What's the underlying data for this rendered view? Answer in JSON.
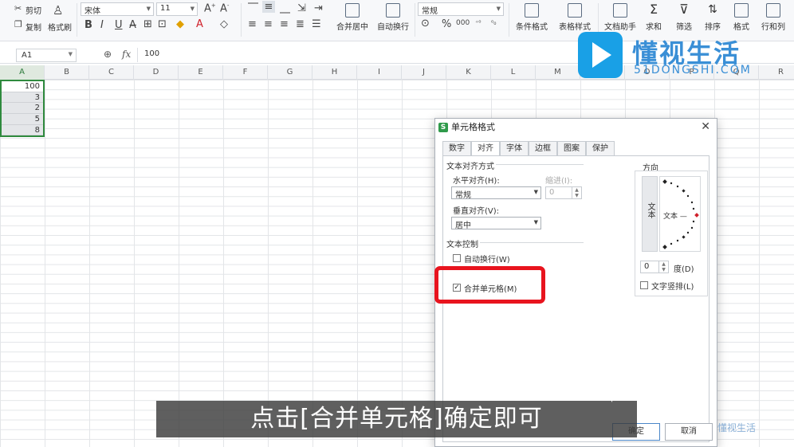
{
  "ribbon": {
    "cut": "剪切",
    "copy": "复制",
    "format_painter": "格式刷",
    "font_name": "宋体",
    "font_size": "11",
    "merge_center": "合并居中",
    "wrap": "自动换行",
    "number_format": "常规",
    "cond_format": "条件格式",
    "table_style": "表格样式",
    "doc_helper": "文档助手",
    "sum": "求和",
    "filter": "筛选",
    "sort": "排序",
    "format": "格式",
    "rows_cols": "行和列"
  },
  "formula_bar": {
    "name_box": "A1",
    "fx": "fx",
    "value": "100"
  },
  "columns": [
    "A",
    "B",
    "C",
    "D",
    "E",
    "F",
    "G",
    "H",
    "I",
    "J",
    "K",
    "L",
    "M",
    "N",
    "O",
    "P",
    "Q",
    "R"
  ],
  "cells": [
    "100",
    "3",
    "2",
    "5",
    "8"
  ],
  "dialog": {
    "title": "单元格格式",
    "tabs": [
      "数字",
      "对齐",
      "字体",
      "边框",
      "图案",
      "保护"
    ],
    "text_align_section": "文本对齐方式",
    "horizontal_label": "水平对齐(H):",
    "horizontal_value": "常规",
    "indent_label": "缩进(I):",
    "indent_value": "0",
    "vertical_label": "垂直对齐(V):",
    "vertical_value": "居中",
    "text_control_section": "文本控制",
    "wrap_label": "自动换行(W)",
    "merge_label": "合并单元格(M)",
    "orientation_section": "方向",
    "vertical_text": "文本",
    "orient_text": "文本 —",
    "degrees_value": "0",
    "degrees_label": "度(D)",
    "vertical_stack_label": "文字竖排(L)",
    "ok": "确定",
    "cancel": "取消"
  },
  "subtitle": "点击[合并单元格]确定即可",
  "watermark": {
    "name": "懂视生活",
    "url": "51DONGSHI.COM",
    "corner": "懂视生活"
  }
}
